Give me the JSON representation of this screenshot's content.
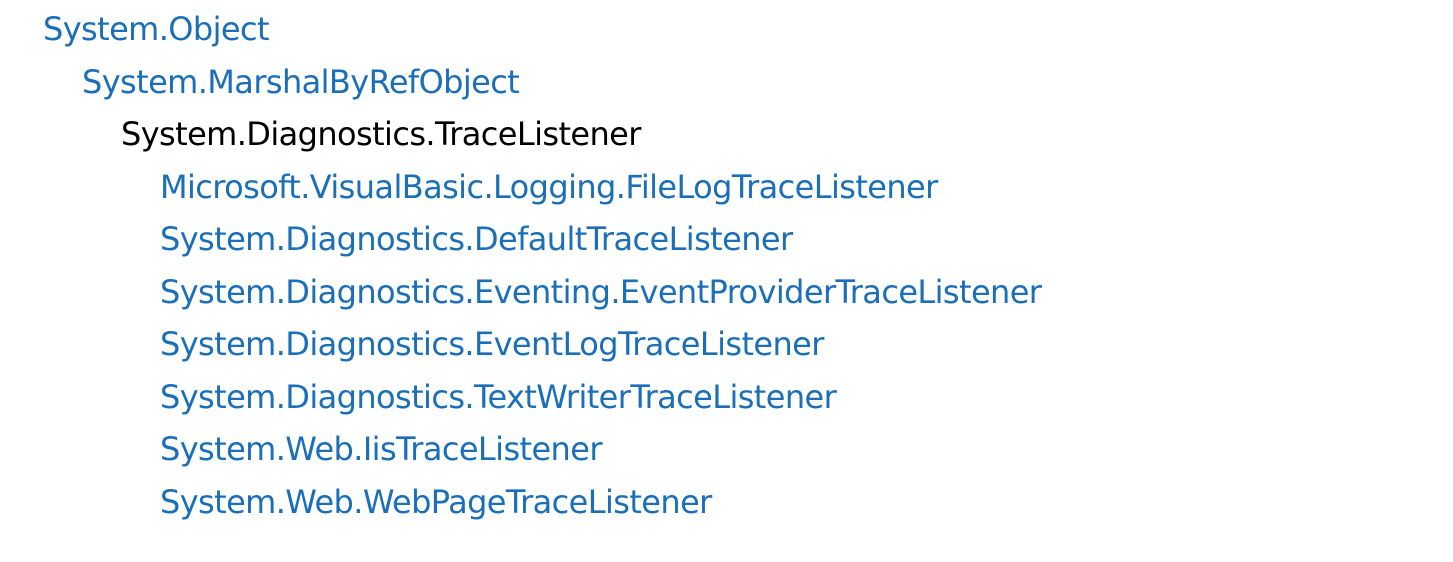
{
  "hierarchy": {
    "ancestors": [
      "System.Object",
      "System.MarshalByRefObject"
    ],
    "current": "System.Diagnostics.TraceListener",
    "derived": [
      "Microsoft.VisualBasic.Logging.FileLogTraceListener",
      "System.Diagnostics.DefaultTraceListener",
      "System.Diagnostics.Eventing.EventProviderTraceListener",
      "System.Diagnostics.EventLogTraceListener",
      "System.Diagnostics.TextWriterTraceListener",
      "System.Web.IisTraceListener",
      "System.Web.WebPageTraceListener"
    ]
  },
  "colors": {
    "link": "#1a6fb8",
    "text": "#000000",
    "background": "#ffffff"
  }
}
